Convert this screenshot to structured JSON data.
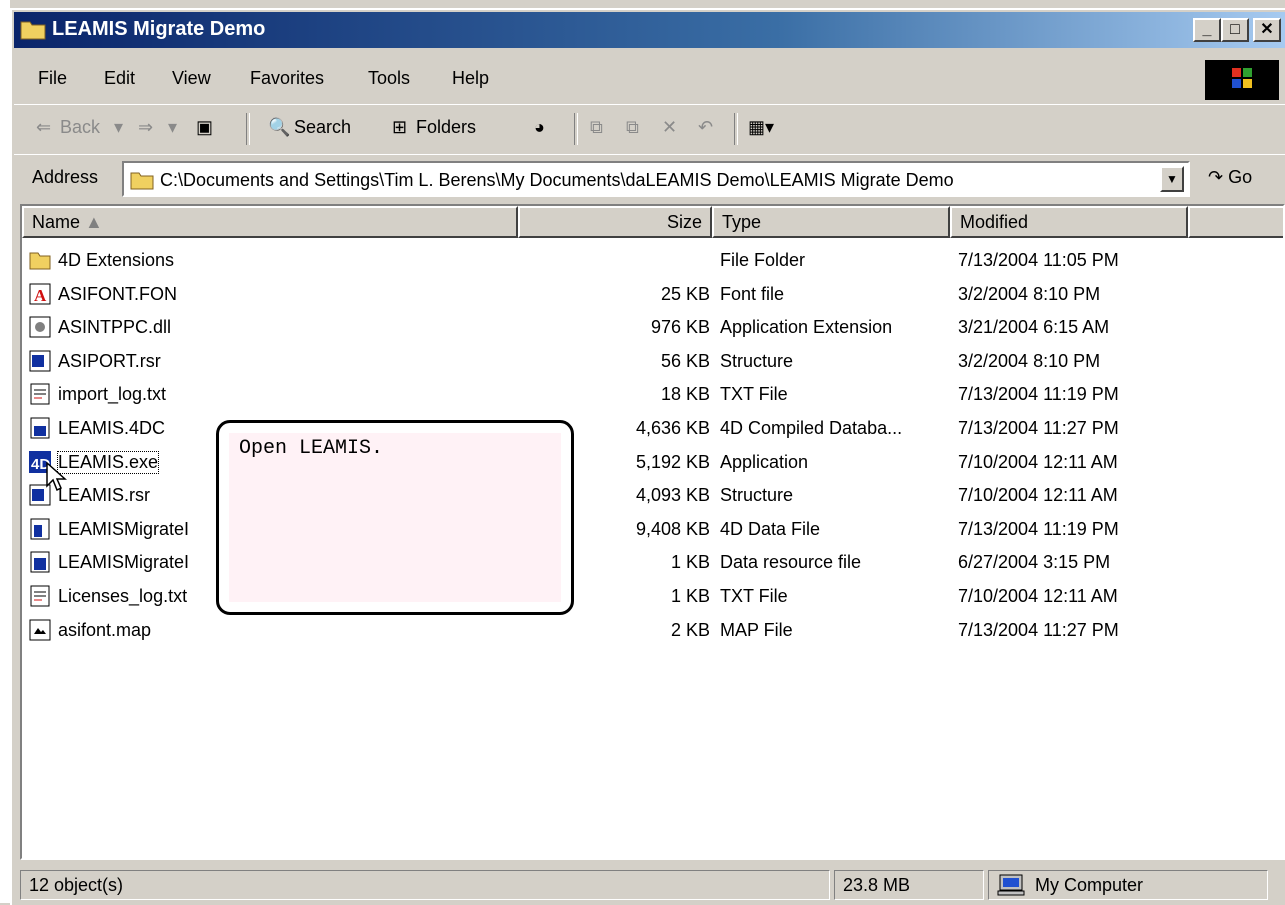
{
  "window": {
    "title": "LEAMIS Migrate Demo",
    "minimize_label": "_",
    "maximize_label": "□",
    "close_label": "✕"
  },
  "menu": {
    "items": [
      "File",
      "Edit",
      "View",
      "Favorites",
      "Tools",
      "Help"
    ]
  },
  "toolbar": {
    "back_label": "Back",
    "search_label": "Search",
    "folders_label": "Folders"
  },
  "address": {
    "label": "Address",
    "value": "C:\\Documents and Settings\\Tim L. Berens\\My Documents\\daLEAMIS Demo\\LEAMIS Migrate Demo",
    "go_label": "Go"
  },
  "columns": {
    "name": "Name",
    "size": "Size",
    "type": "Type",
    "modified": "Modified"
  },
  "files": [
    {
      "name": "4D Extensions",
      "size": "",
      "type": "File Folder",
      "modified": "7/13/2004 11:05 PM",
      "icon": "folder-icon"
    },
    {
      "name": "ASIFONT.FON",
      "size": "25 KB",
      "type": "Font file",
      "modified": "3/2/2004 8:10 PM",
      "icon": "font-file-icon"
    },
    {
      "name": "ASINTPPC.dll",
      "size": "976 KB",
      "type": "Application Extension",
      "modified": "3/21/2004 6:15 AM",
      "icon": "dll-file-icon"
    },
    {
      "name": "ASIPORT.rsr",
      "size": "56 KB",
      "type": "Structure",
      "modified": "3/2/2004 8:10 PM",
      "icon": "structure-file-icon"
    },
    {
      "name": "import_log.txt",
      "size": "18 KB",
      "type": "TXT File",
      "modified": "7/13/2004 11:19 PM",
      "icon": "text-file-icon"
    },
    {
      "name": "LEAMIS.4DC",
      "size": "4,636 KB",
      "type": "4D Compiled Databa...",
      "modified": "7/13/2004 11:27 PM",
      "icon": "compiled-db-icon"
    },
    {
      "name": "LEAMIS.exe",
      "size": "5,192 KB",
      "type": "Application",
      "modified": "7/10/2004 12:11 AM",
      "icon": "app-4d-icon"
    },
    {
      "name": "LEAMIS.rsr",
      "size": "4,093 KB",
      "type": "Structure",
      "modified": "7/10/2004 12:11 AM",
      "icon": "structure-file-icon"
    },
    {
      "name": "LEAMISMigrateI",
      "size": "9,408 KB",
      "type": "4D Data File",
      "modified": "7/13/2004 11:19 PM",
      "icon": "data-file-icon"
    },
    {
      "name": "LEAMISMigrateI",
      "size": "1 KB",
      "type": "Data resource file",
      "modified": "6/27/2004 3:15 PM",
      "icon": "data-resource-icon"
    },
    {
      "name": "Licenses_log.txt",
      "size": "1 KB",
      "type": "TXT File",
      "modified": "7/10/2004 12:11 AM",
      "icon": "text-file-icon"
    },
    {
      "name": "asifont.map",
      "size": "2 KB",
      "type": "MAP File",
      "modified": "7/13/2004 11:27 PM",
      "icon": "map-file-icon"
    }
  ],
  "tooltip": {
    "text": "Open LEAMIS."
  },
  "status": {
    "objects": "12 object(s)",
    "size": "23.8 MB",
    "zone": "My Computer"
  }
}
